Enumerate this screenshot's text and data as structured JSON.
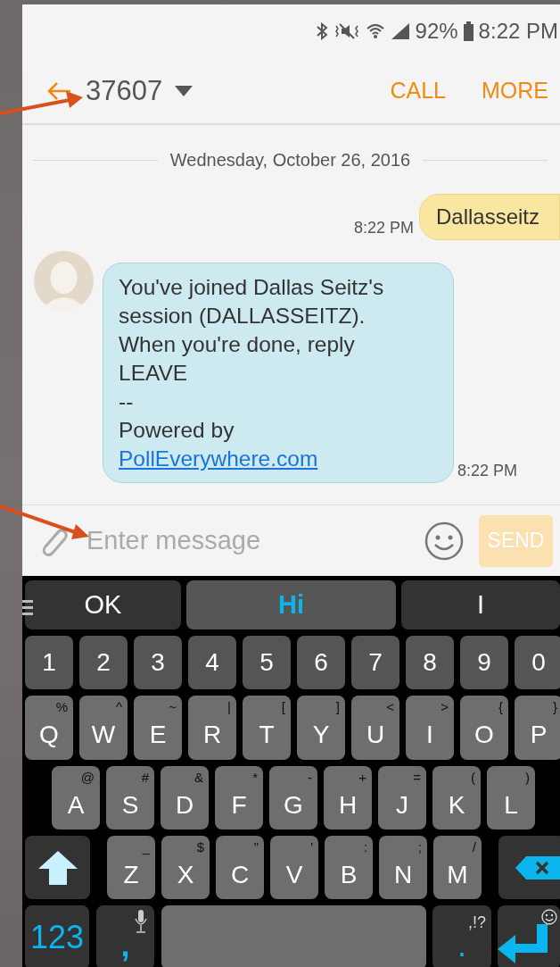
{
  "status_bar": {
    "battery": "92%",
    "time": "8:22 PM"
  },
  "header": {
    "title": "37607",
    "actions": [
      "CALL",
      "MORE"
    ]
  },
  "date_divider": "Wednesday, October 26, 2016",
  "messages": [
    {
      "kind": "outgoing",
      "text": "Dallasseitz",
      "time": "8:22 PM"
    },
    {
      "kind": "incoming",
      "paragraphs": [
        "You've joined Dallas Seitz's session (DALLASSEITZ). When you're done, reply LEAVE",
        "--",
        "Powered by"
      ],
      "link": "PollEverywhere.com",
      "time": "8:22 PM"
    }
  ],
  "composer": {
    "placeholder": "Enter message",
    "send": {
      "label": "SEND",
      "disabled": true
    }
  },
  "keyboard": {
    "suggestions": [
      {
        "text": "OK",
        "selected": false
      },
      {
        "text": "Hi",
        "selected": true
      },
      {
        "text": "I",
        "selected": false
      }
    ],
    "rows": [
      {
        "keys": [
          {
            "kind": "digit",
            "label": "1"
          },
          {
            "kind": "digit",
            "label": "2"
          },
          {
            "kind": "digit",
            "label": "3"
          },
          {
            "kind": "digit",
            "label": "4"
          },
          {
            "kind": "digit",
            "label": "5"
          },
          {
            "kind": "digit",
            "label": "6"
          },
          {
            "kind": "digit",
            "label": "7"
          },
          {
            "kind": "digit",
            "label": "8"
          },
          {
            "kind": "digit",
            "label": "9"
          },
          {
            "kind": "digit",
            "label": "0"
          }
        ]
      },
      {
        "keys": [
          {
            "kind": "letter",
            "label": "Q",
            "alt": "%"
          },
          {
            "kind": "letter",
            "label": "W",
            "alt": "^"
          },
          {
            "kind": "letter",
            "label": "E",
            "alt": "~"
          },
          {
            "kind": "letter",
            "label": "R",
            "alt": "|"
          },
          {
            "kind": "letter",
            "label": "T",
            "alt": "["
          },
          {
            "kind": "letter",
            "label": "Y",
            "alt": "]"
          },
          {
            "kind": "letter",
            "label": "U",
            "alt": "<"
          },
          {
            "kind": "letter",
            "label": "I",
            "alt": ">"
          },
          {
            "kind": "letter",
            "label": "O",
            "alt": "{"
          },
          {
            "kind": "letter",
            "label": "P",
            "alt": "}"
          }
        ]
      },
      {
        "keys": [
          {
            "kind": "letter",
            "label": "A",
            "alt": "@"
          },
          {
            "kind": "letter",
            "label": "S",
            "alt": "#"
          },
          {
            "kind": "letter",
            "label": "D",
            "alt": "&"
          },
          {
            "kind": "letter",
            "label": "F",
            "alt": "*"
          },
          {
            "kind": "letter",
            "label": "G",
            "alt": "-"
          },
          {
            "kind": "letter",
            "label": "H",
            "alt": "+"
          },
          {
            "kind": "letter",
            "label": "J",
            "alt": "="
          },
          {
            "kind": "letter",
            "label": "K",
            "alt": "("
          },
          {
            "kind": "letter",
            "label": "L",
            "alt": ")"
          }
        ]
      },
      {
        "keys": [
          {
            "kind": "shift"
          },
          {
            "kind": "letter",
            "label": "Z",
            "alt": "_"
          },
          {
            "kind": "letter",
            "label": "X",
            "alt": "$"
          },
          {
            "kind": "letter",
            "label": "C",
            "alt": "\""
          },
          {
            "kind": "letter",
            "label": "V",
            "alt": "'"
          },
          {
            "kind": "letter",
            "label": "B",
            "alt": ":"
          },
          {
            "kind": "letter",
            "label": "N",
            "alt": ";"
          },
          {
            "kind": "letter",
            "label": "M",
            "alt": "/"
          },
          {
            "kind": "backspace"
          }
        ]
      },
      {
        "keys": [
          {
            "kind": "symbol",
            "label": "123"
          },
          {
            "kind": "comma",
            "label": ","
          },
          {
            "kind": "space"
          },
          {
            "kind": "symbol",
            "label": ".",
            "alt": ",!?"
          },
          {
            "kind": "enter"
          }
        ]
      }
    ]
  }
}
